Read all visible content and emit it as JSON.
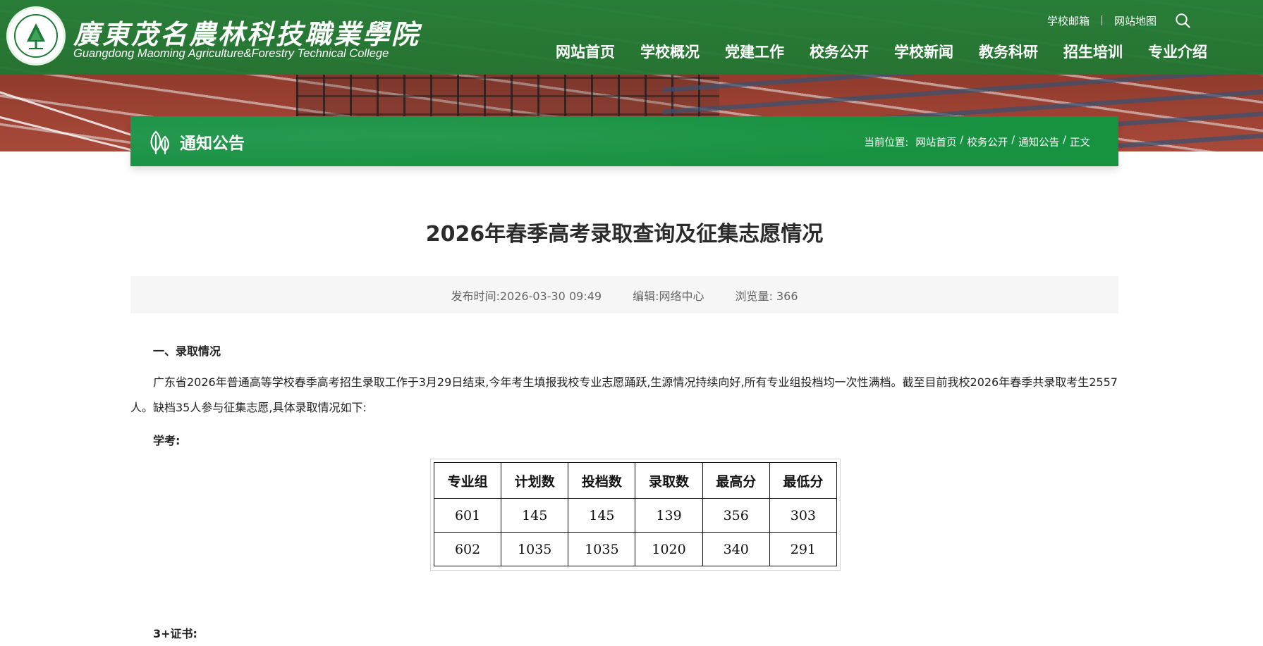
{
  "header": {
    "school_name_cn": "廣東茂名農林科技職業學院",
    "school_name_en": "Guangdong Maoming Agriculture&Forestry Technical College",
    "utility_links": [
      {
        "label": "学校邮箱"
      },
      {
        "label": "网站地图"
      }
    ],
    "nav": [
      {
        "label": "网站首页"
      },
      {
        "label": "学校概况"
      },
      {
        "label": "党建工作"
      },
      {
        "label": "校务公开"
      },
      {
        "label": "学校新闻"
      },
      {
        "label": "教务科研"
      },
      {
        "label": "招生培训"
      },
      {
        "label": "专业介绍"
      }
    ],
    "colors": {
      "primary_green": "#268038",
      "section_green": "#17923f",
      "track_red": "#a9493a"
    }
  },
  "section": {
    "title": "通知公告",
    "breadcrumb_lead": "当前位置:",
    "breadcrumb": [
      "网站首页",
      "校务公开",
      "通知公告",
      "正文"
    ]
  },
  "article": {
    "title": "2026年春季高考录取查询及征集志愿情况",
    "meta": {
      "publish": "发布时间:2026-03-30 09:49",
      "editor": "编辑:网络中心",
      "views_label": "浏览量:",
      "views": "366"
    },
    "heading_1": "一、录取情况",
    "paragraph_1": "广东省2026年普通高等学校春季高考招生录取工作于3月29日结束,今年考生填报我校专业志愿踊跃,生源情况持续向好,所有专业组投档均一次性满档。截至目前我校2026年春季共录取考生2557人。缺档35人参与征集志愿,具体录取情况如下:",
    "label_xuekao": "学考:",
    "table": {
      "headers": [
        "专业组",
        "计划数",
        "投档数",
        "录取数",
        "最高分",
        "最低分"
      ],
      "rows": [
        [
          "601",
          "145",
          "145",
          "139",
          "356",
          "303"
        ],
        [
          "602",
          "1035",
          "1035",
          "1020",
          "340",
          "291"
        ]
      ]
    },
    "label_3plus": "3+证书:"
  },
  "icons": {
    "search": "search-icon",
    "section": "leaf-icon",
    "emblem": "school-emblem-icon"
  }
}
